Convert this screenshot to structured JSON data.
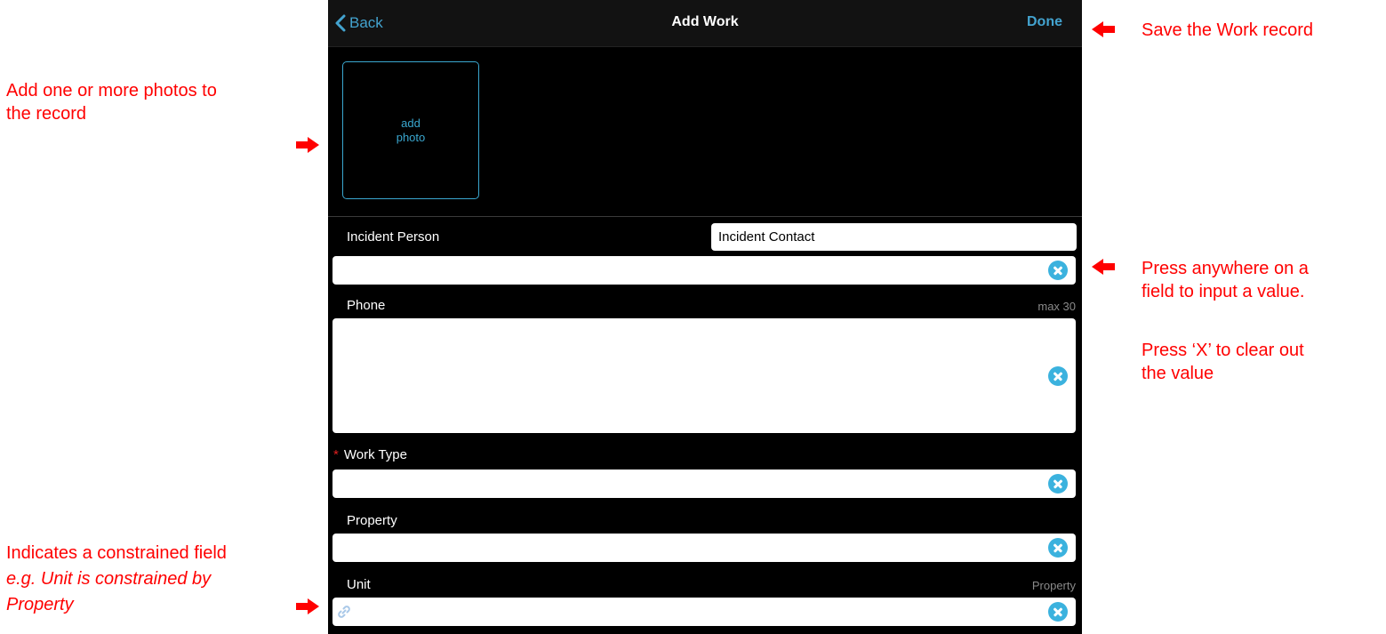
{
  "navbar": {
    "back_label": "Back",
    "title": "Add Work",
    "done_label": "Done"
  },
  "photo": {
    "add_label_line1": "add",
    "add_label_line2": "photo"
  },
  "form": {
    "incident_person": {
      "label": "Incident Person",
      "contact_label": "Incident Contact",
      "value": ""
    },
    "phone": {
      "label": "Phone",
      "hint": "max 30",
      "value": ""
    },
    "work_type": {
      "label": "Work Type",
      "required_marker": "*",
      "value": ""
    },
    "property": {
      "label": "Property",
      "value": ""
    },
    "unit": {
      "label": "Unit",
      "hint": "Property",
      "value": ""
    }
  },
  "annotations": {
    "photos_line1": "Add one or more photos to",
    "photos_line2": "the record",
    "save": "Save the Work record",
    "press_line1": "Press anywhere on a",
    "press_line2": "field to input a value.",
    "clear_line1": "Press ‘X’ to clear out",
    "clear_line2": "the value",
    "constrained_line1": "Indicates a constrained field",
    "constrained_line2": "e.g. Unit is constrained by",
    "constrained_line3": "Property"
  },
  "colors": {
    "annotation": "#ff0000",
    "accent": "#43a3cf",
    "background": "#000000"
  }
}
